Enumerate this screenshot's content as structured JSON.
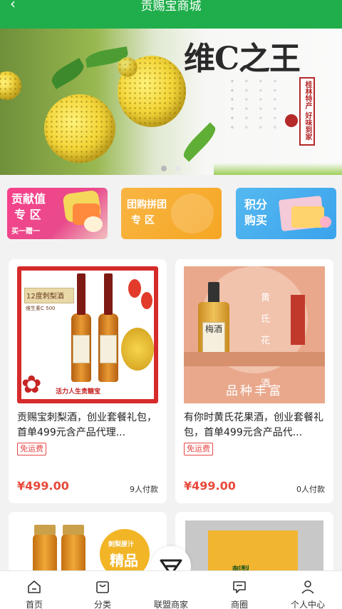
{
  "header": {
    "back_icon": "back-arrow-icon",
    "title": "贡赐宝商城"
  },
  "banner": {
    "headline": "维C之王",
    "seal_text": "桂林特产 好味到家",
    "active_dot": 0,
    "dot_count": 2
  },
  "promos": [
    {
      "title_line1": "贡献值",
      "title_line2": "专 区",
      "small": "买一赠一",
      "color": "#f6418a"
    },
    {
      "title_line1": "团购拼团",
      "title_line2": "专 区",
      "small": "",
      "color": "#f8b543"
    },
    {
      "title_line1": "积分",
      "title_line2": "购买",
      "small": "",
      "color": "#3aa3ec"
    }
  ],
  "products": [
    {
      "image_badge": "12度刺梨酒",
      "image_sub": "维生素C 500",
      "image_banner": "活力人生贵糖宝",
      "name": "贡赐宝刺梨酒，创业套餐礼包，首单499元含产品代理...",
      "tag": "免运费",
      "price": "¥499.00",
      "sold": "9人付款"
    },
    {
      "image_vertical": "黄氏花果酒",
      "image_bottle_label": "梅酒",
      "image_slogan": "品种丰富",
      "name": "有你时黄氏花果酒，创业套餐礼包，首单499元含产品代...",
      "tag": "免运费",
      "price": "¥499.00",
      "sold": "0人付款"
    },
    {
      "image_badge": "刺梨原汁",
      "image_big": "精品"
    },
    {
      "image_text": "刺梨"
    }
  ],
  "tabbar": {
    "tabs": [
      {
        "label": "首页",
        "icon": "home-icon"
      },
      {
        "label": "分类",
        "icon": "bag-icon"
      },
      {
        "label": "联盟商家",
        "icon": "diamond-icon"
      },
      {
        "label": "商圈",
        "icon": "chat-icon"
      },
      {
        "label": "个人中心",
        "icon": "person-icon"
      }
    ]
  }
}
